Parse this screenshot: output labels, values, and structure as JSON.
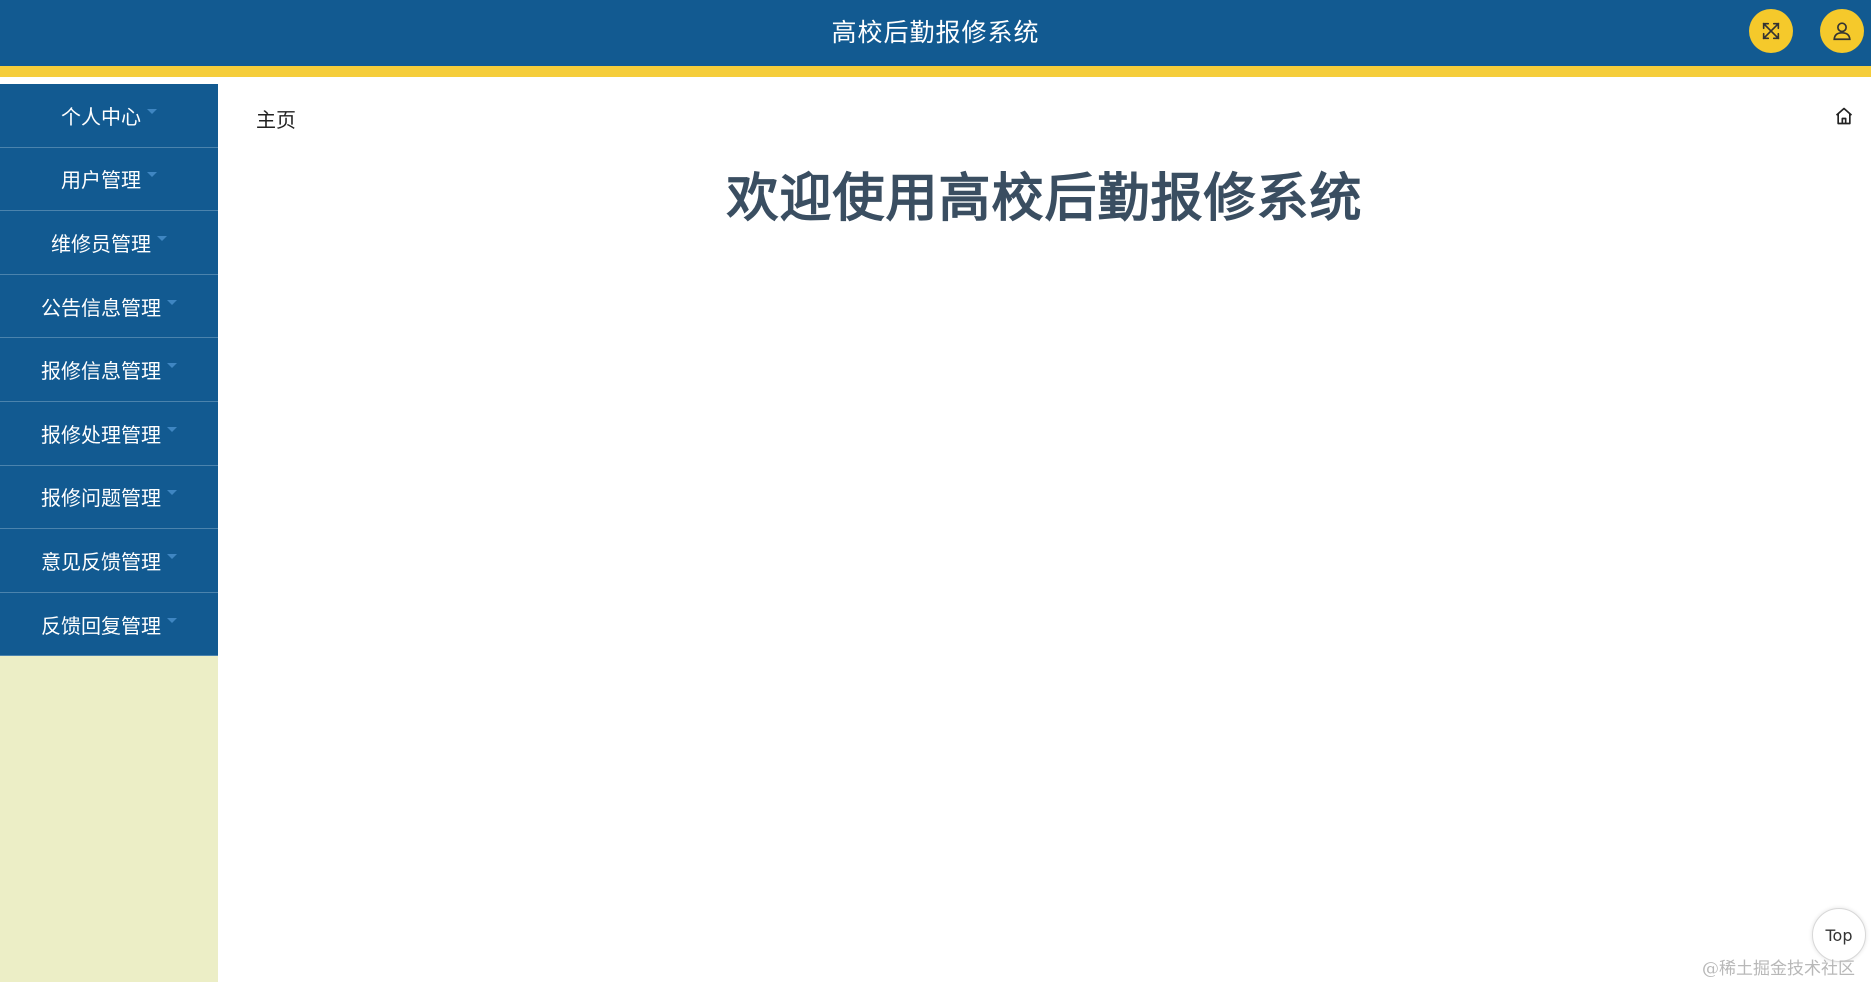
{
  "header": {
    "title": "高校后勤报修系统",
    "fullscreen_icon": "fullscreen-icon",
    "user_icon": "user-icon",
    "bg_color": "#125a91",
    "accent_color": "#f5cd3b"
  },
  "sidebar": {
    "items": [
      {
        "label": "个人中心"
      },
      {
        "label": "用户管理"
      },
      {
        "label": "维修员管理"
      },
      {
        "label": "公告信息管理"
      },
      {
        "label": "报修信息管理"
      },
      {
        "label": "报修处理管理"
      },
      {
        "label": "报修问题管理"
      },
      {
        "label": "意见反馈管理"
      },
      {
        "label": "反馈回复管理"
      }
    ]
  },
  "main": {
    "breadcrumb": "主页",
    "home_icon": "home-icon",
    "welcome": "欢迎使用高校后勤报修系统"
  },
  "back_to_top": {
    "label": "Top"
  },
  "watermark": "@稀土掘金技术社区"
}
